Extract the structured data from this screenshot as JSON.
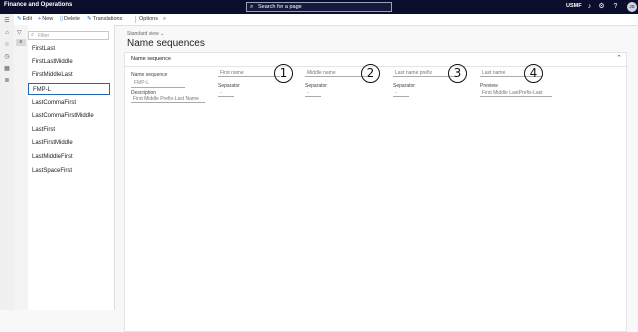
{
  "topbar": {
    "app_title": "Finance and Operations",
    "search_placeholder": "Search for a page",
    "company": "USMF",
    "user_initials": "JS"
  },
  "actions": {
    "edit": "Edit",
    "new": "New",
    "delete": "Delete",
    "translations": "Translations",
    "options": "Options"
  },
  "list": {
    "filter_placeholder": "Filter",
    "items": [
      "FirstLast",
      "FirstLastMiddle",
      "FirstMiddleLast",
      "FMP-L",
      "LastCommaFirst",
      "LastCommaFirstMiddle",
      "LastFirst",
      "LastFirstMiddle",
      "LastMiddleFirst",
      "LastSpaceFirst"
    ],
    "selected_index": 3
  },
  "main": {
    "view_label": "Standard view",
    "page_title": "Name sequences",
    "section_title": "Name sequence",
    "name_sequence_label": "Name sequence",
    "name_sequence_value": "FMP-L",
    "description_label": "Description",
    "description_value": "First Middle Prefix-Last Name",
    "fields": [
      "First name",
      "Middle name",
      "Last name prefix",
      "Last name"
    ],
    "separator_label": "Separator",
    "separator_value": "-",
    "preview_label": "Preview",
    "preview_value": "First Middle LastPrefix-Last",
    "callouts": [
      "1",
      "2",
      "3",
      "4"
    ]
  }
}
